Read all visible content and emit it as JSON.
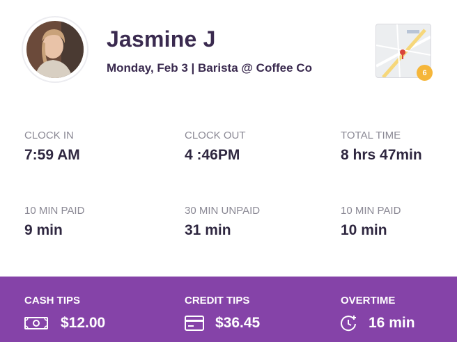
{
  "profile": {
    "name": "Jasmine J",
    "subline": "Monday, Feb 3 | Barista @ Coffee Co"
  },
  "map": {
    "badge_count": "6"
  },
  "stats": [
    {
      "label": "CLOCK IN",
      "value": "7:59  AM"
    },
    {
      "label": "CLOCK OUT",
      "value": "4 :46PM"
    },
    {
      "label": "TOTAL TIME",
      "value": "8 hrs  47min"
    },
    {
      "label": "10 MIN PAID",
      "value": "9 min"
    },
    {
      "label": "30 MIN UNPAID",
      "value": "31 min"
    },
    {
      "label": "10 MIN PAID",
      "value": "10 min"
    }
  ],
  "footer": {
    "cash": {
      "label": "CASH TIPS",
      "value": "$12.00",
      "icon": "cash-icon"
    },
    "credit": {
      "label": "CREDIT TIPS",
      "value": "$36.45",
      "icon": "credit-card-icon"
    },
    "overtime": {
      "label": "OVERTIME",
      "value": "16 min",
      "icon": "clock-plus-icon"
    }
  },
  "colors": {
    "accent": "#8543a8",
    "text_dark": "#3a2a4f",
    "label_gray": "#8a8894",
    "badge": "#f5b63a"
  }
}
